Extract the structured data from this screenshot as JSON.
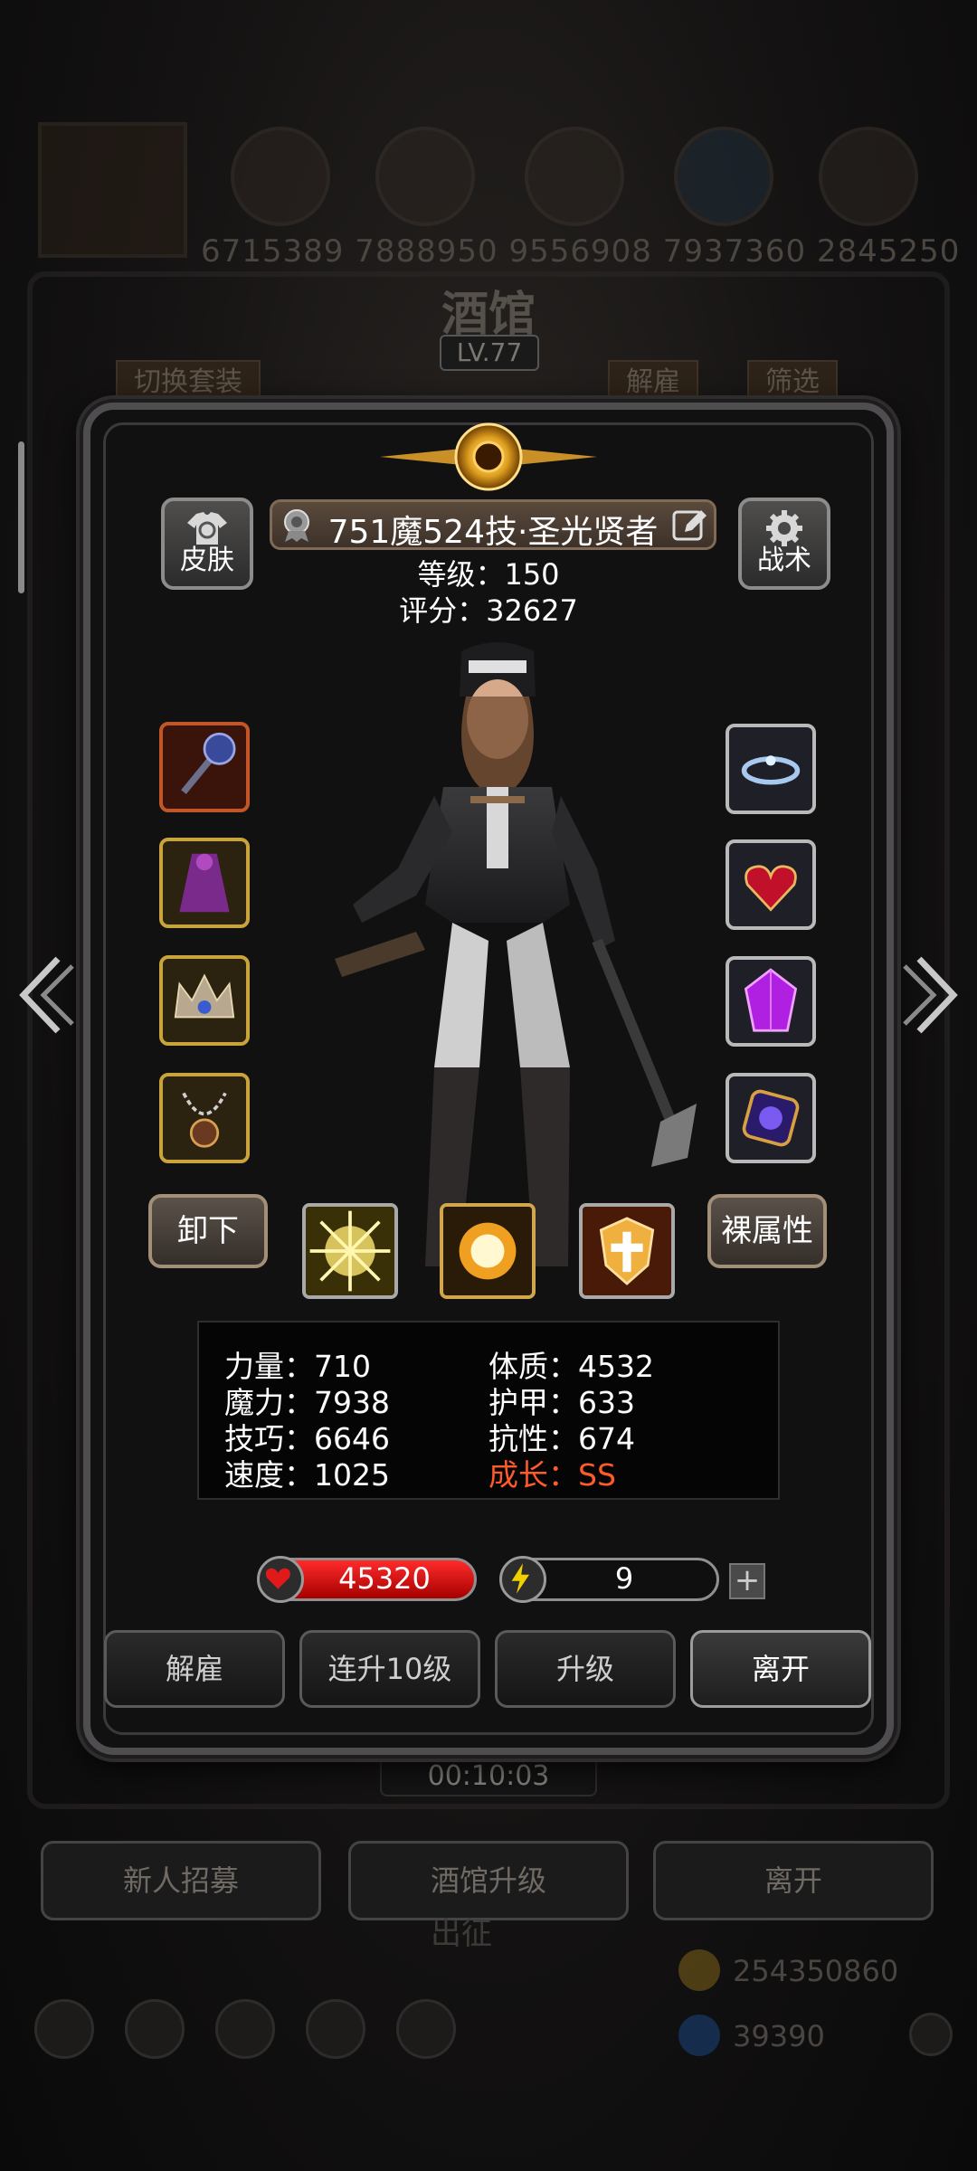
{
  "background": {
    "number_strip": "6715389 7888950 9556908 7937360 2845250",
    "title": "酒馆",
    "level": "LV.77",
    "switch_outfit": "切换套装",
    "dismiss_tab": "解雇",
    "filter_tab": "筛选",
    "timer": "00:10:03",
    "bottom_buttons": [
      "新人招募",
      "酒馆升级",
      "离开"
    ],
    "sortie_label": "出征",
    "gold": "254350860",
    "gems": "39390"
  },
  "hero": {
    "name": "751魔524技·圣光贤者",
    "level_label": "等级：150",
    "score_label": "评分：32627"
  },
  "buttons": {
    "skin": "皮肤",
    "tactics": "战术",
    "unequip": "卸下",
    "base_attributes": "裸属性"
  },
  "equipment": {
    "left_slots": [
      "staff-weapon-icon",
      "robe-armor-icon",
      "crown-helmet-icon",
      "necklace-icon"
    ],
    "right_slots": [
      "halo-ring-icon",
      "heart-amulet-icon",
      "purple-gem-icon",
      "orb-accessory-icon"
    ]
  },
  "skills": [
    "holy-burst-icon",
    "sun-orb-icon",
    "holy-shield-icon"
  ],
  "stats": {
    "strength": "力量：710",
    "constitution": "体质：4532",
    "magic": "魔力：7938",
    "armor": "护甲：633",
    "skill": "技巧：6646",
    "resistance": "抗性：674",
    "speed": "速度：1025",
    "growth": "成长：SS"
  },
  "vitals": {
    "hp": "45320",
    "energy": "9",
    "energy_fraction": 0.05
  },
  "actions": {
    "dismiss": "解雇",
    "level_up_10": "连升10级",
    "level_up": "升级",
    "leave": "离开"
  },
  "colors": {
    "hp_red": "#d40000",
    "energy_yellow": "#e6c800",
    "growth_text": "#ff5a2a"
  }
}
